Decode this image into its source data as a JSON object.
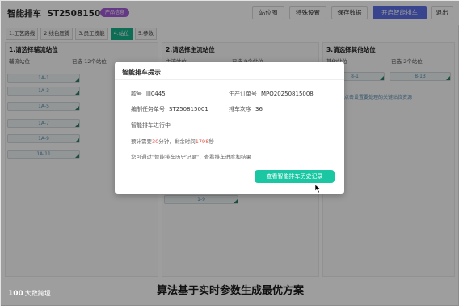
{
  "header": {
    "title": "智能排车",
    "order_no": "ST250815001",
    "status_badge": "产品信息",
    "buttons": {
      "station_map": "站位图",
      "special_settings": "特殊设置",
      "save": "保存数据",
      "start_smart": "开启智能排车",
      "exit": "退出"
    }
  },
  "tabs": [
    {
      "label": "1.工艺路线"
    },
    {
      "label": "2.线色压脚"
    },
    {
      "label": "3.员工技能"
    },
    {
      "label": "4.站位"
    },
    {
      "label": "5.参数"
    }
  ],
  "active_tab": "4.站位",
  "panels": {
    "aux": {
      "title": "1.请选择辅流站位",
      "sub_left": "辅流站位",
      "sub_right": "已选 12个站位",
      "slots": [
        "1A-1",
        "1A-3",
        "1A-5",
        "1A-7",
        "1A-9",
        "1A-11"
      ]
    },
    "main": {
      "title": "2.请选择主流站位",
      "sub_left": "主流站位",
      "sub_right": "已选 9个站位",
      "slots": [
        "1-9"
      ]
    },
    "other": {
      "title": "3.请选择其他站位",
      "sub_left": "其他站位",
      "sub_right": "已选 2个站位",
      "slots": [
        "8-1",
        "8-13"
      ],
      "hint": "点击设置要处理的关键站位资源"
    }
  },
  "dialog": {
    "title": "智能排车提示",
    "style_no_label": "款号",
    "style_no": "lll0445",
    "prod_order_label": "生产订单号",
    "prod_order": "MPO20250815008",
    "task_no_label": "编制任务单号",
    "task_no": "ST250815001",
    "sequence_label": "排车次序",
    "sequence": "36",
    "status": "智能排车进行中",
    "estimate_prefix": "预计需要",
    "estimate_minutes": "30",
    "estimate_middle": "分钟，剩余时间",
    "remaining_seconds": "1798",
    "estimate_suffix": "秒",
    "history_note": "您可通过\"智能排车历史记录\"，查看排车进度和结果",
    "history_button": "查看智能排车历史记录"
  },
  "caption": "算法基于实时参数生成最优方案",
  "watermark": {
    "mark": "100",
    "text": "大数跨境"
  }
}
